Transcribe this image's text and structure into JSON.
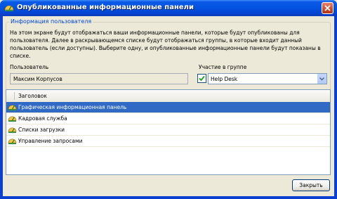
{
  "window": {
    "title": "Опубликованные информационные панели"
  },
  "user_info": {
    "legend": "Информация пользователя",
    "description": "На этом экране будут отображаться ваши информационные панели, которые будут опубликованы для пользователя. Далее в раскрывающемся списке будут отображаться группы, в которые входит данный пользователь (если доступны). Выберите одну, и опубликованные информационные панели будут показаны в списке.",
    "user_label": "Пользователь",
    "user_value": "Максим Корпусов",
    "group_label": "Участие в группе",
    "group_checked": true,
    "group_value": "Help Desk"
  },
  "list": {
    "header": "Заголовок",
    "items": [
      {
        "label": "Графическая информационная панель",
        "selected": true
      },
      {
        "label": "Кадровая служба",
        "selected": false
      },
      {
        "label": "Списки загрузки",
        "selected": false
      },
      {
        "label": "Управление запросами",
        "selected": false
      }
    ]
  },
  "buttons": {
    "close": "Закрыть"
  },
  "colors": {
    "title_bar": "#0454e1",
    "selection": "#316ac5",
    "legend_text": "#0046d5"
  }
}
